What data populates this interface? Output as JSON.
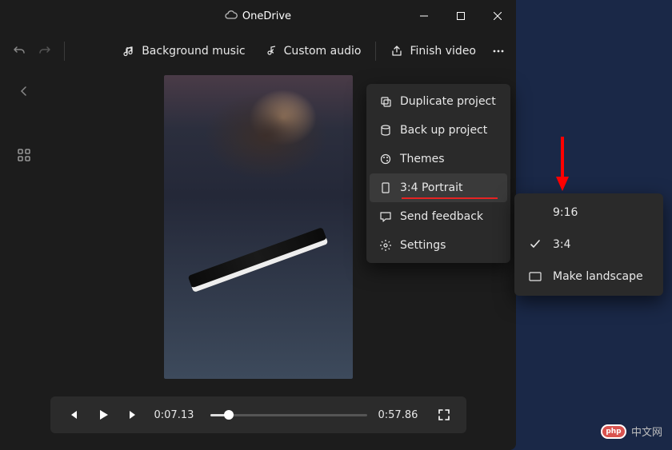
{
  "titlebar": {
    "title": "OneDrive"
  },
  "toolbar": {
    "bg_music": "Background music",
    "custom_audio": "Custom audio",
    "finish_video": "Finish video"
  },
  "player": {
    "current_time": "0:07.13",
    "total_time": "0:57.86"
  },
  "more_menu": {
    "items": [
      {
        "label": "Duplicate project"
      },
      {
        "label": "Back up project"
      },
      {
        "label": "Themes"
      },
      {
        "label": "3:4 Portrait"
      },
      {
        "label": "Send feedback"
      },
      {
        "label": "Settings"
      }
    ]
  },
  "aspect_flyout": {
    "items": [
      {
        "label": "9:16"
      },
      {
        "label": "3:4"
      },
      {
        "label": "Make landscape"
      }
    ]
  },
  "watermark": {
    "badge": "php",
    "text": "中文网"
  }
}
